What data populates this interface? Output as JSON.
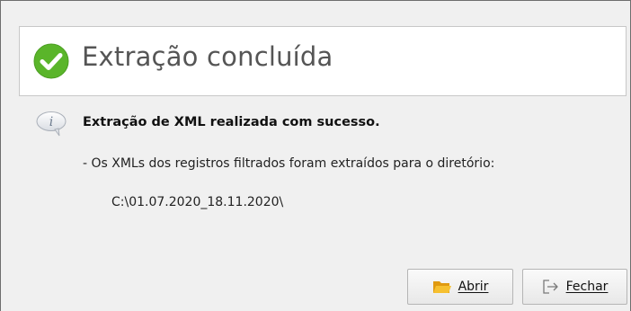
{
  "dialog": {
    "title": "Extração concluída",
    "message": "Extração de XML realizada com sucesso.",
    "detail": "- Os XMLs dos registros filtrados foram extraídos para o diretório:",
    "path": "C:\\01.07.2020_18.11.2020\\",
    "icons": {
      "title_icon": "check-circle-icon",
      "message_icon": "info-icon"
    },
    "colors": {
      "success": "#5ab52a",
      "folder": "#f2b21c"
    }
  },
  "buttons": {
    "open": {
      "label": "Abrir",
      "icon": "folder-open-icon"
    },
    "close": {
      "label": "Fechar",
      "icon": "exit-icon"
    }
  }
}
